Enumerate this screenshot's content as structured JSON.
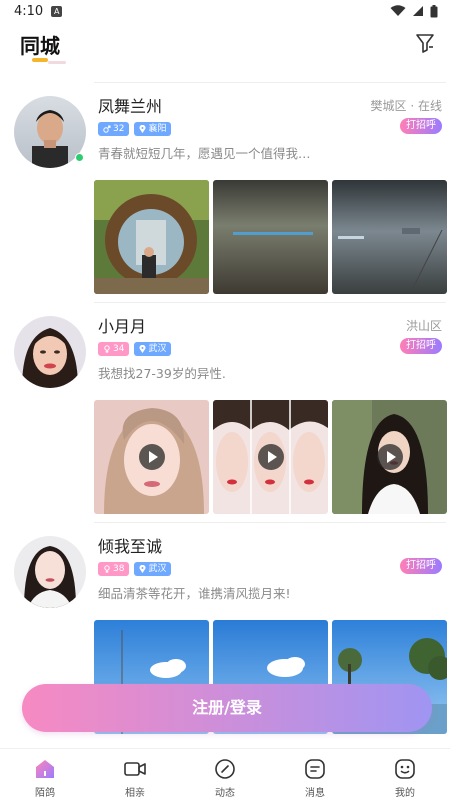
{
  "status_bar": {
    "time": "4:10",
    "notif_letter": "A"
  },
  "header": {
    "title": "同城"
  },
  "icons": {
    "filter": "filter-icon",
    "wifi": "wifi-icon",
    "signal": "signal-icon",
    "battery": "battery-icon",
    "play": "play-icon",
    "male": "male-icon",
    "female": "female-icon",
    "pin": "location-pin-icon"
  },
  "colors": {
    "accent_pink": "#ff7eb6",
    "accent_purple": "#9b7bff",
    "tag_blue": "#6fa8ff",
    "tag_pink": "#ff98c6",
    "online_green": "#2ecc71",
    "title_underline": "#f5b52c"
  },
  "feed": [
    {
      "name": "凤舞兰州",
      "location": "樊城区 · 在线",
      "online": true,
      "gender": "male",
      "age": "32",
      "city": "襄阳",
      "bio": "青春就短短几年，愿遇见一个值得我…",
      "greet_label": "打招呼",
      "media": [
        "photo",
        "photo",
        "photo"
      ]
    },
    {
      "name": "小月月",
      "location": "洪山区",
      "online": false,
      "gender": "female",
      "age": "34",
      "city": "武汉",
      "bio": "我想找27-39岁的异性.",
      "greet_label": "打招呼",
      "media": [
        "video",
        "video",
        "video"
      ]
    },
    {
      "name": "倾我至诚",
      "location": "",
      "online": false,
      "gender": "female",
      "age": "38",
      "city": "武汉",
      "bio": "细品清茶等花开，谁携清风揽月来!",
      "greet_label": "打招呼",
      "media": [
        "photo",
        "photo",
        "photo"
      ]
    }
  ],
  "login_button": "注册/登录",
  "bottom_nav": [
    {
      "label": "陌鸽",
      "icon": "home-icon",
      "active": true
    },
    {
      "label": "相亲",
      "icon": "video-camera-icon",
      "active": false
    },
    {
      "label": "动态",
      "icon": "compass-icon",
      "active": false
    },
    {
      "label": "消息",
      "icon": "message-icon",
      "active": false
    },
    {
      "label": "我的",
      "icon": "profile-icon",
      "active": false
    }
  ]
}
